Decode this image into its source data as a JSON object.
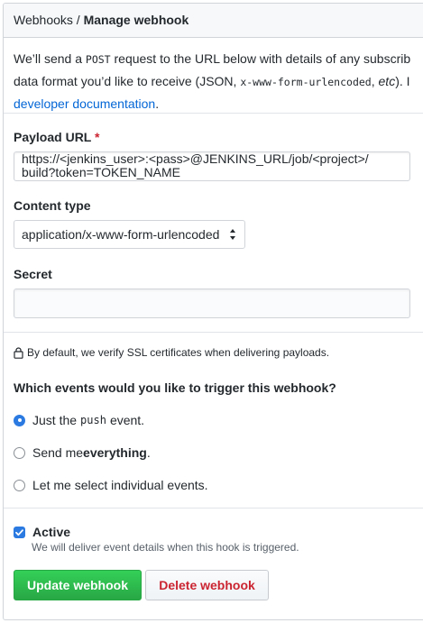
{
  "header": {
    "breadcrumb_parent": "Webhooks",
    "breadcrumb_separator": "/",
    "title": "Manage webhook"
  },
  "intro": {
    "line1_pre": "We’ll send a ",
    "line1_code": "POST",
    "line1_post": " request to the URL below with details of any subscrib",
    "line2_pre": "data format you’d like to receive (JSON, ",
    "line2_code": "x-www-form-urlencoded",
    "line2_mid": ", ",
    "line2_em": "etc",
    "line2_post": "). I",
    "link": "developer documentation",
    "link_end": "."
  },
  "payload": {
    "label": "Payload URL",
    "required_mark": "*",
    "value_line1": "https://<jenkins_user>:<pass>@JENKINS_URL/job/<project>/",
    "value_line2": "build?token=TOKEN_NAME"
  },
  "content_type": {
    "label": "Content type",
    "selected": "application/x-www-form-urlencoded"
  },
  "secret": {
    "label": "Secret",
    "value": ""
  },
  "ssl_note": "By default, we verify SSL certificates when delivering payloads.",
  "events": {
    "question": "Which events would you like to trigger this webhook?",
    "options": [
      {
        "pre": "Just the",
        "code": "push",
        "post": "event.",
        "checked": true
      },
      {
        "pre": "Send me ",
        "bold": "everything",
        "post": ".",
        "checked": false
      },
      {
        "label": "Let me select individual events.",
        "checked": false
      }
    ]
  },
  "active": {
    "label": "Active",
    "checked": true,
    "note": "We will deliver event details when this hook is triggered."
  },
  "buttons": {
    "update": "Update webhook",
    "delete": "Delete webhook"
  },
  "colors": {
    "accent": "#2a7ae2",
    "link": "#0366d6",
    "primary_button": "#28a745",
    "danger_text": "#cb2431",
    "header_bg": "#f6f8fa"
  }
}
